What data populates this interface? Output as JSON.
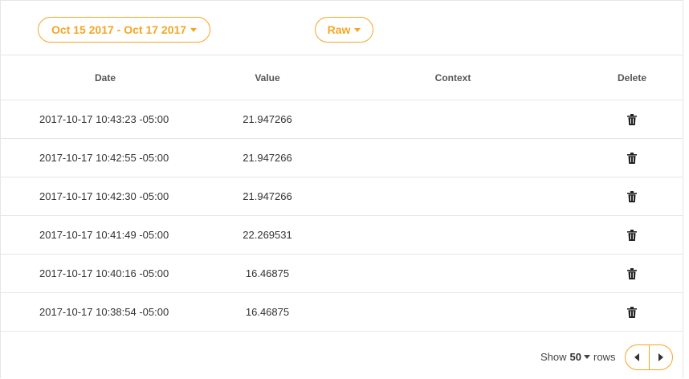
{
  "toolbar": {
    "date_range_label": "Oct 15 2017 - Oct 17 2017",
    "mode_label": "Raw"
  },
  "table": {
    "columns": [
      "Date",
      "Value",
      "Context",
      "Delete"
    ],
    "rows": [
      {
        "date": "2017-10-17 10:43:23 -05:00",
        "value": "21.947266",
        "context": ""
      },
      {
        "date": "2017-10-17 10:42:55 -05:00",
        "value": "21.947266",
        "context": ""
      },
      {
        "date": "2017-10-17 10:42:30 -05:00",
        "value": "21.947266",
        "context": ""
      },
      {
        "date": "2017-10-17 10:41:49 -05:00",
        "value": "22.269531",
        "context": ""
      },
      {
        "date": "2017-10-17 10:40:16 -05:00",
        "value": "16.46875",
        "context": ""
      },
      {
        "date": "2017-10-17 10:38:54 -05:00",
        "value": "16.46875",
        "context": ""
      }
    ]
  },
  "footer": {
    "show_label": "Show",
    "rows_count": "50",
    "rows_label": "rows"
  },
  "colors": {
    "accent": "#f5a623",
    "border": "#e6e6e6"
  },
  "icons": {
    "delete": "trash-icon",
    "prev": "chevron-left-icon",
    "next": "chevron-right-icon",
    "dropdown": "caret-down-icon"
  }
}
